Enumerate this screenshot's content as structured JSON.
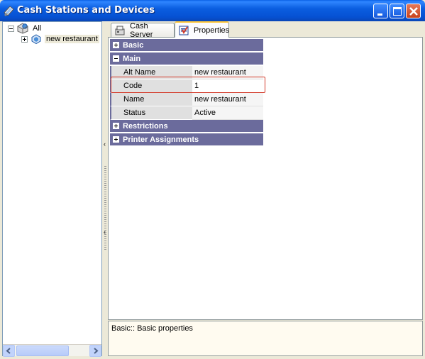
{
  "window": {
    "title": "Cash Stations and Devices",
    "icon": "cash-station-icon"
  },
  "titlebar_buttons": {
    "minimize": "minimize-icon",
    "maximize": "maximize-icon",
    "close": "close-icon"
  },
  "tree": {
    "root": {
      "label": "All",
      "expanded": true,
      "icon": "globe-folder-icon"
    },
    "children": [
      {
        "label": "new restaurant",
        "expanded": false,
        "selected": true,
        "icon": "restaurant-node-icon"
      }
    ]
  },
  "tabs": [
    {
      "label": "Cash Server",
      "active": false,
      "icon": "cash-server-icon"
    },
    {
      "label": "Properties",
      "active": true,
      "icon": "properties-icon"
    }
  ],
  "property_grid": {
    "categories": [
      {
        "name": "Basic",
        "expanded": false,
        "properties": []
      },
      {
        "name": "Main",
        "expanded": true,
        "properties": [
          {
            "name": "Alt Name",
            "value": "new restaurant"
          },
          {
            "name": "Code",
            "value": "1",
            "highlighted": true
          },
          {
            "name": "Name",
            "value": "new restaurant"
          },
          {
            "name": "Status",
            "value": "Active"
          }
        ]
      },
      {
        "name": "Restrictions",
        "expanded": false,
        "properties": []
      },
      {
        "name": "Printer Assignments",
        "expanded": false,
        "properties": []
      }
    ]
  },
  "description": {
    "text": "Basic:: Basic properties"
  },
  "colors": {
    "category_header": "#6b6b9c",
    "titlebar": "#0651d3",
    "highlight_border": "#d33b2b"
  }
}
